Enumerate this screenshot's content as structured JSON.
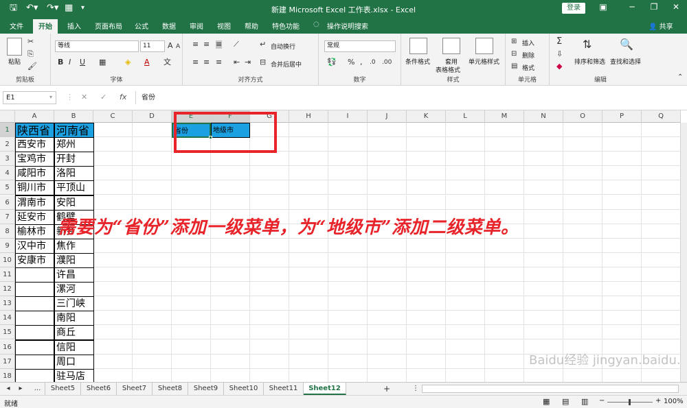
{
  "window": {
    "title": "新建 Microsoft Excel 工作表.xlsx - Excel",
    "login": "登录",
    "share": "共享"
  },
  "tabs": [
    "文件",
    "开始",
    "插入",
    "页面布局",
    "公式",
    "数据",
    "审阅",
    "视图",
    "帮助",
    "特色功能",
    "操作说明搜索"
  ],
  "ribbon": {
    "clipboard": {
      "label": "剪贴板",
      "paste": "粘贴"
    },
    "font": {
      "label": "字体",
      "name": "等线",
      "size": "11",
      "bold": "B",
      "italic": "I",
      "underline": "U",
      "grow": "A",
      "shrink": "A",
      "fontcolor": "A"
    },
    "align": {
      "label": "对齐方式",
      "wrap": "自动换行",
      "merge": "合并后居中"
    },
    "number": {
      "label": "数字",
      "format": "常规",
      "percent": "%"
    },
    "styles": {
      "label": "样式",
      "cond": "条件格式",
      "table1": "套用",
      "table2": "表格格式",
      "cell": "单元格样式"
    },
    "cells": {
      "label": "单元格",
      "insert": "插入",
      "delete": "删除",
      "format": "格式"
    },
    "edit": {
      "label": "编辑",
      "sum": "Σ",
      "sort": "排序和筛选",
      "find": "查找和选择"
    }
  },
  "formulaBar": {
    "namebox": "E1",
    "cancel": "✕",
    "enter": "✓",
    "fx": "fx",
    "value": "省份"
  },
  "columns": [
    "A",
    "B",
    "C",
    "D",
    "E",
    "F",
    "G",
    "H",
    "I",
    "J",
    "K",
    "L",
    "M",
    "N",
    "O",
    "P",
    "Q"
  ],
  "rows": [
    "1",
    "2",
    "3",
    "4",
    "5",
    "6",
    "7",
    "8",
    "9",
    "10",
    "11",
    "12",
    "13",
    "14",
    "15",
    "16",
    "17",
    "18"
  ],
  "colA": [
    "陕西省",
    "西安市",
    "宝鸡市",
    "咸阳市",
    "铜川市",
    "渭南市",
    "延安市",
    "榆林市",
    "汉中市",
    "安康市"
  ],
  "colB": [
    "河南省",
    "郑州",
    "开封",
    "洛阳",
    "平顶山",
    "安阳",
    "鹤壁",
    "新乡",
    "焦作",
    "濮阳",
    "许昌",
    "漯河",
    "三门峡",
    "南阳",
    "商丘",
    "信阳",
    "周口",
    "驻马店"
  ],
  "E1": "省份",
  "F1": "地级市",
  "annotation": "需要为“省份”添加一级菜单，为“地级市”添加二级菜单。",
  "sheets": [
    "...",
    "Sheet5",
    "Sheet6",
    "Sheet7",
    "Sheet8",
    "Sheet9",
    "Sheet10",
    "Sheet11",
    "Sheet12"
  ],
  "addSheet": "+",
  "status": {
    "ready": "就绪",
    "zoom": "100%"
  },
  "watermark": "Baidu经验 jingyan.baidu.com",
  "colors": {
    "excelGreen": "#217346",
    "headerFill": "#1ba1e2",
    "annotation": "#e8232a",
    "highlightBox": "#e8232a"
  }
}
